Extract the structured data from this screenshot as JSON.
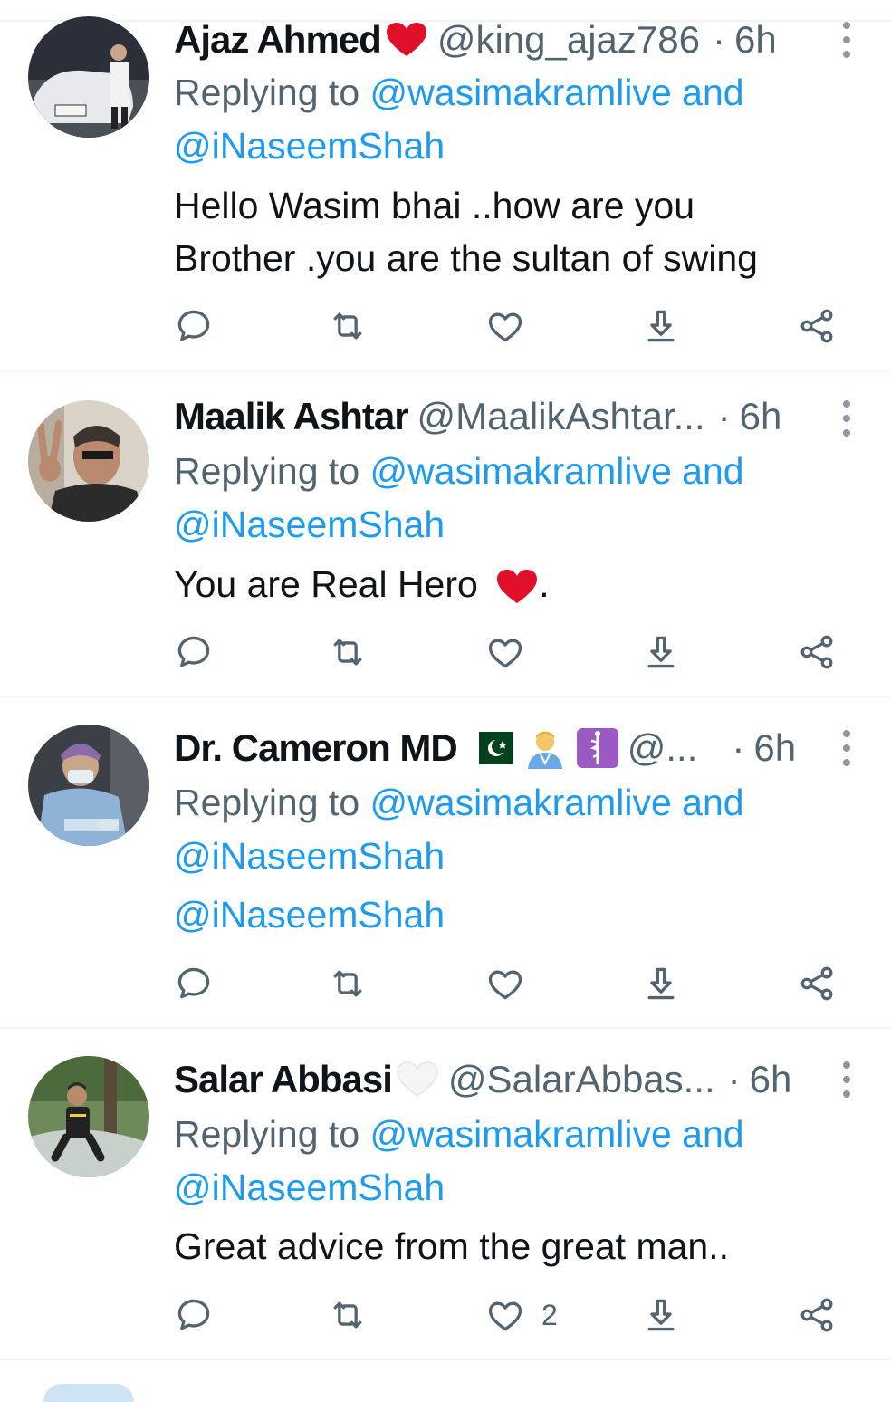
{
  "tweets": [
    {
      "name": "Ajaz Ahmed",
      "handle": "@king_ajaz786",
      "separator": "·",
      "time": "6h",
      "badge": "red-heart-emoji",
      "replying_prefix": "Replying to",
      "replying_to_1": "@wasimakramlive",
      "replying_and": "and",
      "replying_to_2": "@iNaseemShah",
      "text_lines": [
        "Hello Wasim bhai ..how are you",
        "Brother .you are the sultan of swing"
      ],
      "like_count": ""
    },
    {
      "name": "Maalik Ashtar",
      "handle": "@MaalikAshtar...",
      "separator": "·",
      "time": "6h",
      "replying_prefix": "Replying to",
      "replying_to_1": "@wasimakramlive",
      "replying_and": "and",
      "replying_to_2": "@iNaseemShah",
      "text_lines": [
        "You are Real Hero"
      ],
      "text_suffix": ".",
      "text_emoji": "red-heart-emoji",
      "like_count": ""
    },
    {
      "name": "Dr. Cameron MD",
      "handle": "@...",
      "separator": "·",
      "time": "6h",
      "emojis": [
        "pakistan-flag-emoji",
        "health-worker-emoji",
        "medical-symbol-emoji"
      ],
      "replying_prefix": "Replying to",
      "replying_to_1": "@wasimakramlive",
      "replying_and": "and",
      "replying_to_2": "@iNaseemShah",
      "text_lines": [
        "@iNaseemShah"
      ],
      "like_count": ""
    },
    {
      "name": "Salar Abbasi",
      "handle": "@SalarAbbas...",
      "separator": "·",
      "time": "6h",
      "badge": "white-heart-emoji",
      "replying_prefix": "Replying to",
      "replying_to_1": "@wasimakramlive",
      "replying_and": "and",
      "replying_to_2": "@iNaseemShah",
      "text_lines": [
        "Great advice from the great man.."
      ],
      "like_count": "2"
    }
  ],
  "colors": {
    "link": "#1d9bf0",
    "secondary": "#536471",
    "primary_text": "#0f1419",
    "divider": "#eff3f4",
    "heart_red": "#e0102a"
  },
  "icons": [
    "reply-icon",
    "retweet-icon",
    "like-icon",
    "share-down-icon",
    "share-nodes-icon",
    "more-options-icon"
  ]
}
